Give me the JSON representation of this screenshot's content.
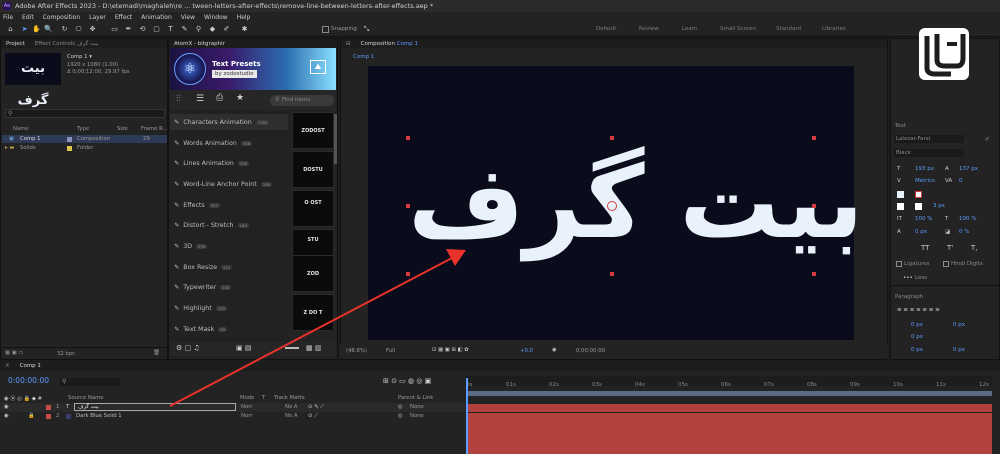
{
  "title": "Adobe After Effects 2023 - D:\\etemadi\\maghaleh\\re ... tween-letters-after-effects\\remove-line-between-letters-after-effects.aep *",
  "app_icon": "Ae",
  "menu": [
    "File",
    "Edit",
    "Composition",
    "Layer",
    "Effect",
    "Animation",
    "View",
    "Window",
    "Help"
  ],
  "toolbar": {
    "snapping": "Snapping"
  },
  "workspaces": [
    "Default",
    "Review",
    "Learn",
    "Small Screen",
    "Standard",
    "Libraries"
  ],
  "project_panel": {
    "tabs": [
      "Project",
      "Effect Controls بیت گرف"
    ],
    "comp_info": [
      "Comp 1 ▾",
      "1920 x 1080 (1.00)",
      "Δ 0;00;12;00, 29.97 fps"
    ],
    "thumb_text": "بیت گرف",
    "columns": [
      "Name",
      "Type",
      "Size",
      "Frame R..."
    ],
    "rows": [
      {
        "name": "Comp 1",
        "type": "Composition",
        "frame": "29"
      },
      {
        "name": "Solids",
        "type": "Folder",
        "frame": ""
      }
    ],
    "footer": "32 bpc"
  },
  "atomx": {
    "tab": "AtomX - bitgraphir",
    "header_title": "Text Presets",
    "header_sub": "by zodostudio",
    "search_placeholder": "Find items",
    "categories": [
      {
        "label": "Characters Animation",
        "count": "1283"
      },
      {
        "label": "Words Animation",
        "count": "538"
      },
      {
        "label": "Lines Animation",
        "count": "338"
      },
      {
        "label": "Word-Line Anchor Point",
        "count": "236"
      },
      {
        "label": "Effects",
        "count": "317"
      },
      {
        "label": "Distort - Stretch",
        "count": "183"
      },
      {
        "label": "3D",
        "count": "233"
      },
      {
        "label": "Box Resize",
        "count": "211"
      },
      {
        "label": "Typewriter",
        "count": "133"
      },
      {
        "label": "Highlight",
        "count": "133"
      },
      {
        "label": "Text Mask",
        "count": "93"
      }
    ],
    "previews": [
      "ZODOST",
      "DOSTU",
      "O OST",
      "STU",
      "ZOD",
      "Z DO T"
    ]
  },
  "composition": {
    "tab": "Composition",
    "tab_name": "Comp 1",
    "subtab": "Comp 1",
    "text": "بیت گرف",
    "zoom": "(48.8%)",
    "resolution": "Full",
    "exposure": "+0.0",
    "timecode": "0;00;00;00"
  },
  "right_panel": {
    "text_header": "Text",
    "font": "Lalezar-Farsi",
    "font_style": "Black",
    "size": "193 px",
    "leading": "137 px",
    "kerning": "Metrics",
    "tracking": "0",
    "stroke": "3 px",
    "vscale": "100 %",
    "hscale": "100 %",
    "baseline": "0 px",
    "tsume": "0 %",
    "faux": [
      "TT",
      "T'",
      "T,"
    ],
    "ligatures": "Ligatures",
    "hindi": "Hindi Digits",
    "less": "Less",
    "paragraph": "Paragraph",
    "para_values": [
      "0 px",
      "0 px",
      "0 px",
      "0 px",
      "0 px"
    ]
  },
  "timeline": {
    "tab": "Comp 1",
    "timecode": "0:00:00:00",
    "columns": {
      "source": "Source Name",
      "mode": "Mode",
      "t": "T",
      "track": "Track Matte",
      "parent": "Parent & Link"
    },
    "layers": [
      {
        "num": "1",
        "type": "T",
        "name": "بیت گرف",
        "mode": "Norr",
        "track": "No A",
        "parent": "None"
      },
      {
        "num": "2",
        "type": "",
        "name": "Dark Blue Solid 1",
        "mode": "Norr",
        "track": "No A",
        "parent": "None"
      }
    ],
    "ticks": [
      "0s",
      "01s",
      "02s",
      "03s",
      "04s",
      "05s",
      "06s",
      "07s",
      "08s",
      "09s",
      "10s",
      "11s",
      "12s"
    ]
  },
  "colors": {
    "label_red": "#c94a47",
    "bar": "#b3423f",
    "comp_bg": "#0a0b1b",
    "text": "#e9f2fb",
    "arrow": "#e8322a",
    "accent_blue": "#5a9cff"
  }
}
